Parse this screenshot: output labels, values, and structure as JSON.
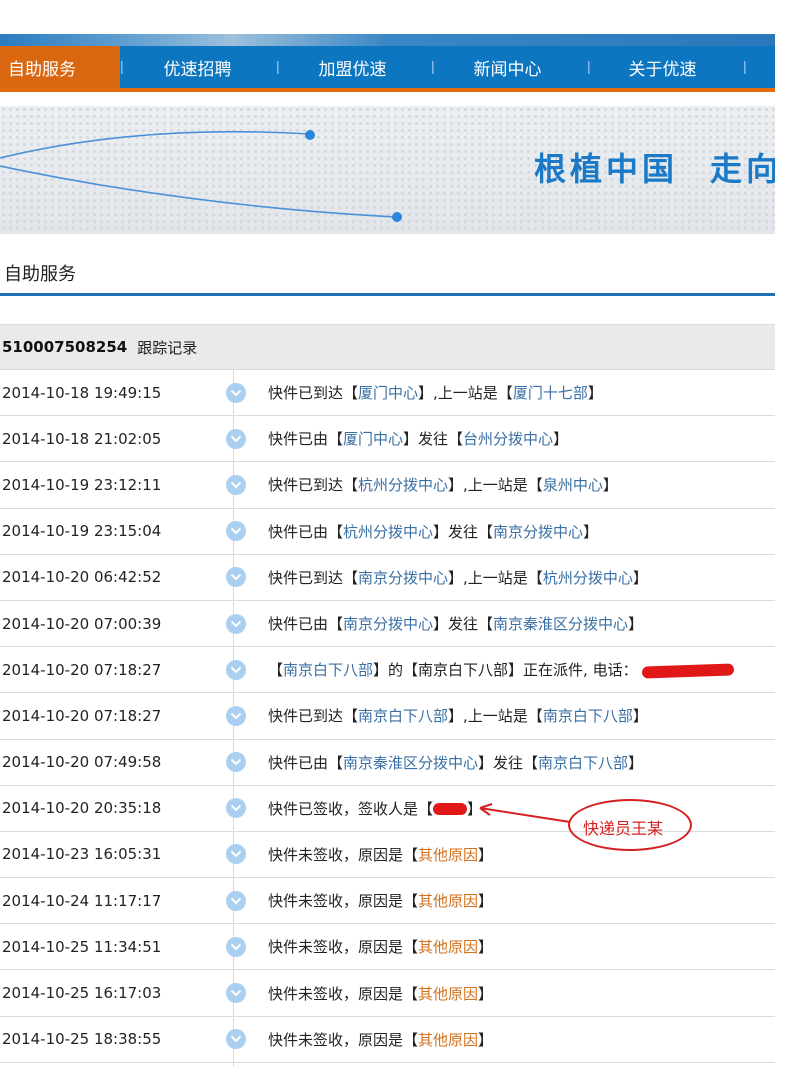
{
  "nav": {
    "items": [
      {
        "label": "自助服务",
        "active": true
      },
      {
        "label": "优速招聘"
      },
      {
        "label": "加盟优速"
      },
      {
        "label": "新闻中心"
      },
      {
        "label": "关于优速"
      }
    ]
  },
  "banner": {
    "slogan_left": "根植中国",
    "slogan_right": "走向"
  },
  "section": {
    "title": "自助服务"
  },
  "tracking": {
    "number": "510007508254",
    "caption": "跟踪记录",
    "rows": [
      {
        "time": "2014-10-18 19:49:15",
        "t1": "快件已到达【",
        "l1": "厦门中心",
        "t2": "】,上一站是【",
        "l2": "厦门十七部",
        "t3": "】"
      },
      {
        "time": "2014-10-18 21:02:05",
        "t1": "快件已由【",
        "l1": "厦门中心",
        "t2": "】发往【",
        "l2": "台州分拨中心",
        "t3": "】"
      },
      {
        "time": "2014-10-19 23:12:11",
        "t1": "快件已到达【",
        "l1": "杭州分拨中心",
        "t2": "】,上一站是【",
        "l2": "泉州中心",
        "t3": "】"
      },
      {
        "time": "2014-10-19 23:15:04",
        "t1": "快件已由【",
        "l1": "杭州分拨中心",
        "t2": "】发往【",
        "l2": "南京分拨中心",
        "t3": "】"
      },
      {
        "time": "2014-10-20 06:42:52",
        "t1": "快件已到达【",
        "l1": "南京分拨中心",
        "t2": "】,上一站是【",
        "l2": "杭州分拨中心",
        "t3": "】"
      },
      {
        "time": "2014-10-20 07:00:39",
        "t1": "快件已由【",
        "l1": "南京分拨中心",
        "t2": "】发往【",
        "l2": "南京秦淮区分拨中心",
        "t3": "】"
      },
      {
        "time": "2014-10-20 07:18:27",
        "t1": "【",
        "l1": "南京白下八部",
        "t2": "】的【南京白下八部】正在派件, 电话：",
        "l2": "",
        "t3": "",
        "redacted": "phone"
      },
      {
        "time": "2014-10-20 07:18:27",
        "t1": "快件已到达【",
        "l1": "南京白下八部",
        "t2": "】,上一站是【",
        "l2": "南京白下八部",
        "t3": "】"
      },
      {
        "time": "2014-10-20 07:49:58",
        "t1": "快件已由【",
        "l1": "南京秦淮区分拨中心",
        "t2": "】发往【",
        "l2": "南京白下八部",
        "t3": "】"
      },
      {
        "time": "2014-10-20 20:35:18",
        "t1": "快件已签收，签收人是【",
        "l1": "",
        "t2": "】",
        "l2": "",
        "t3": "",
        "redacted": "signer"
      },
      {
        "time": "2014-10-23 16:05:31",
        "t1": "快件未签收，原因是【",
        "r1": "其他原因",
        "t2": "】"
      },
      {
        "time": "2014-10-24 11:17:17",
        "t1": "快件未签收，原因是【",
        "r1": "其他原因",
        "t2": "】"
      },
      {
        "time": "2014-10-25 11:34:51",
        "t1": "快件未签收，原因是【",
        "r1": "其他原因",
        "t2": "】"
      },
      {
        "time": "2014-10-25 16:17:03",
        "t1": "快件未签收，原因是【",
        "r1": "其他原因",
        "t2": "】"
      },
      {
        "time": "2014-10-25 18:38:55",
        "t1": "快件未签收，原因是【",
        "r1": "其他原因",
        "t2": "】"
      }
    ]
  },
  "annotation": {
    "text": "快递员王某"
  },
  "colors": {
    "nav_bg": "#0d76c1",
    "nav_active": "#d8670f",
    "location_link": "#3a6fa4",
    "reason": "#d4711c",
    "annotation": "#d42020"
  }
}
